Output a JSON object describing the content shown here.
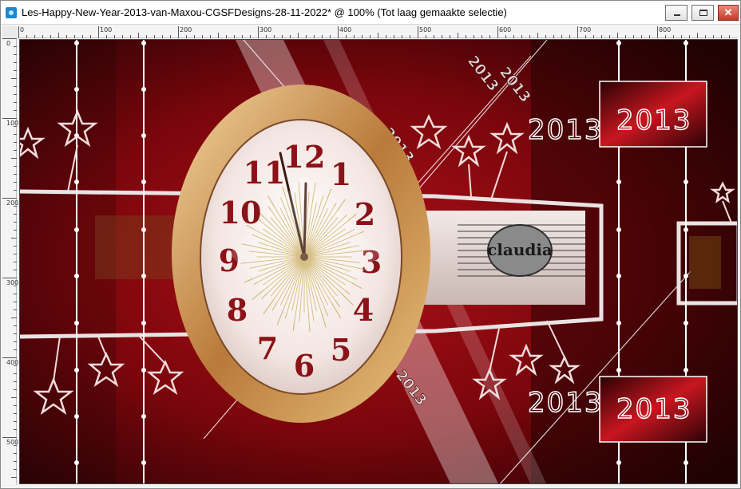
{
  "window": {
    "title": "Les-Happy-New-Year-2013-van-Maxou-CGSFDesigns-28-11-2022* @ 100% (Tot laag gemaakte selectie)",
    "buttons": {
      "minimize": "minimize",
      "maximize": "maximize",
      "close": "✕"
    }
  },
  "ruler": {
    "horizontal": [
      "0",
      "100",
      "200",
      "300",
      "400",
      "500",
      "600",
      "700",
      "800"
    ],
    "vertical": [
      "0",
      "100",
      "200",
      "300",
      "400",
      "500"
    ]
  },
  "artwork": {
    "year_labels": [
      "2013",
      "2013",
      "2013",
      "2013"
    ],
    "diagonal_labels": [
      "2013",
      "2013",
      "2013",
      "2013"
    ],
    "watermark": "claudia",
    "clock_numbers": [
      "12",
      "1",
      "2",
      "3",
      "4",
      "5",
      "6",
      "7",
      "8",
      "9",
      "10",
      "11"
    ],
    "colors": {
      "background": "#3a0507",
      "accent_red": "#c4121a",
      "frame_gold": "#c9914a",
      "line_white": "#ffffff"
    }
  }
}
